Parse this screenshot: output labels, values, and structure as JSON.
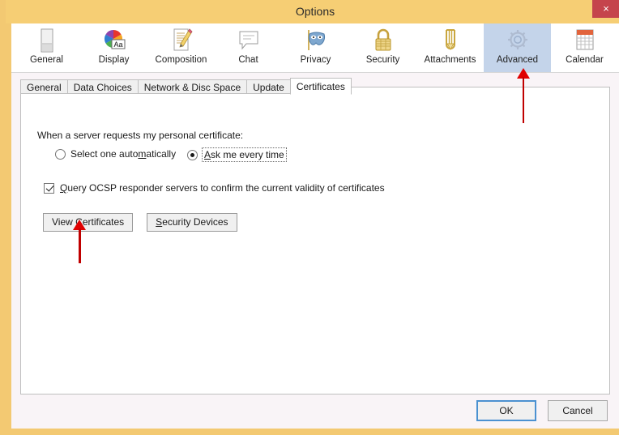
{
  "window": {
    "title": "Options",
    "close_label": "×",
    "frame_color": "#f3c972",
    "titlebar_color": "#f6ce74",
    "close_color": "#c5444c"
  },
  "toolbar": {
    "selected": "Advanced",
    "selected_color": "#c4d4ea",
    "items": [
      {
        "label": "General",
        "icon": "general-panel-icon"
      },
      {
        "label": "Display",
        "icon": "display-colorwheel-icon"
      },
      {
        "label": "Composition",
        "icon": "composition-pencil-icon"
      },
      {
        "label": "Chat",
        "icon": "chat-bubble-icon"
      },
      {
        "label": "Privacy",
        "icon": "privacy-mask-icon"
      },
      {
        "label": "Security",
        "icon": "security-padlock-icon"
      },
      {
        "label": "Attachments",
        "icon": "attachments-paperclip-icon"
      },
      {
        "label": "Advanced",
        "icon": "advanced-gear-icon"
      },
      {
        "label": "Calendar",
        "icon": "calendar-icon"
      }
    ]
  },
  "tabs": {
    "active": "Certificates",
    "items": [
      {
        "label": "General"
      },
      {
        "label": "Data Choices"
      },
      {
        "label": "Network & Disc Space"
      },
      {
        "label": "Update"
      },
      {
        "label": "Certificates"
      }
    ]
  },
  "certificates_panel": {
    "prompt_label": "When a server requests my personal certificate:",
    "radio_auto": {
      "label_pre": "Select one auto",
      "label_mnemonic": "m",
      "label_post": "atically",
      "checked": false
    },
    "radio_ask": {
      "label_mnemonic": "A",
      "label_post": "sk me every time",
      "checked": true,
      "focused": true
    },
    "ocsp_checkbox": {
      "label_mnemonic": "Q",
      "label_post": "uery OCSP responder servers to confirm the current validity of certificates",
      "checked": true
    },
    "view_certificates_button": {
      "label_pre": "View ",
      "label_mnemonic": "C",
      "label_post": "ertificates"
    },
    "security_devices_button": {
      "label_mnemonic": "S",
      "label_post": "ecurity Devices"
    }
  },
  "footer": {
    "ok_label": "OK",
    "cancel_label": "Cancel",
    "default_focus_color": "#4b91d1"
  },
  "annotations": {
    "arrow_color": "#c00000",
    "arrow_advanced": "points up to Advanced toolbar button",
    "arrow_view_certificates": "points up to View Certificates button"
  }
}
